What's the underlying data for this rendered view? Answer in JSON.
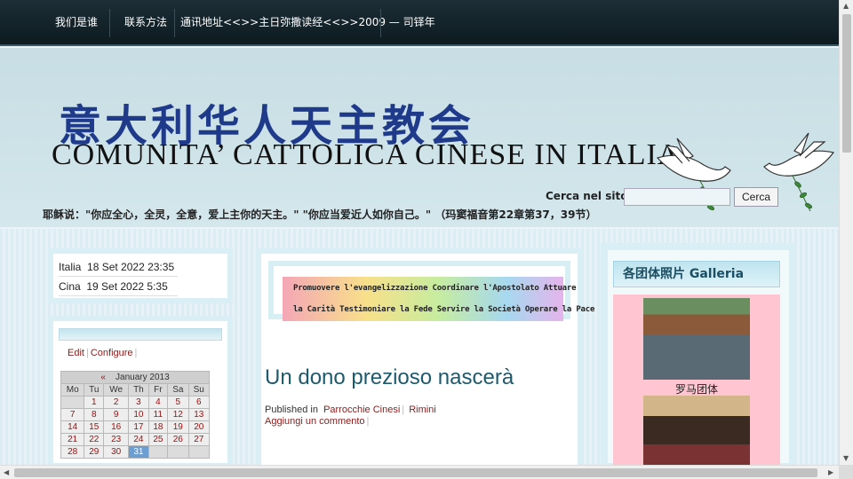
{
  "nav": {
    "items": [
      "我们是谁",
      "联系方法",
      "通讯地址<<>>主日弥撒读经<<>>2009 — 司铎年"
    ]
  },
  "header": {
    "site_name_cn": "意大利华人天主教会",
    "site_name_it": "COMUNITA’ CATTOLICA CINESE IN ITALIA",
    "search_label": "Cerca nel sito:",
    "search_value": "",
    "search_button": "Cerca",
    "verse": "耶稣说：\"你应全心，全灵，全意，爱上主你的天主。\" \"你应当爱近人如你自己。\" （玛窦福音第22章第37，39节）"
  },
  "clock": {
    "rows": [
      {
        "label": "Italia",
        "value": "18 Set 2022 23:35"
      },
      {
        "label": "Cina",
        "value": "19 Set 2022 5:35"
      }
    ]
  },
  "widget": {
    "edit": "Edit",
    "configure": "Configure"
  },
  "calendar": {
    "prev": "«",
    "month": "January 2013",
    "weekdays": [
      "Mo",
      "Tu",
      "We",
      "Th",
      "Fr",
      "Sa",
      "Su"
    ],
    "weeks": [
      [
        "",
        "1",
        "2",
        "3",
        "4",
        "5",
        "6"
      ],
      [
        "7",
        "8",
        "9",
        "10",
        "11",
        "12",
        "13"
      ],
      [
        "14",
        "15",
        "16",
        "17",
        "18",
        "19",
        "20"
      ],
      [
        "21",
        "22",
        "23",
        "24",
        "25",
        "26",
        "27"
      ],
      [
        "28",
        "29",
        "30",
        "31",
        "",
        "",
        ""
      ]
    ],
    "today": "31"
  },
  "banner": {
    "line1": "Promuovere l'evangelizzazione  Coordinare l'Apostolato  Attuare",
    "line2": "la Carità  Testimoniare la Fede  Servire la Società  Operare la Pace"
  },
  "post": {
    "title": "Un dono prezioso nascerà",
    "published_in": "Published in",
    "category_1": "Parrocchie Cinesi",
    "category_2": "Rimini",
    "comment": "Aggiungi un commento"
  },
  "gallery": {
    "title": "各团体照片 Galleria",
    "photo_1_caption": "罗马团体"
  },
  "colors": {
    "nav_bg": "#14232a",
    "title_blue": "#1f3a8a",
    "link_red": "#8b1a1a",
    "post_title": "#1c5a6e",
    "gallery_bg": "#ffc6d1"
  }
}
